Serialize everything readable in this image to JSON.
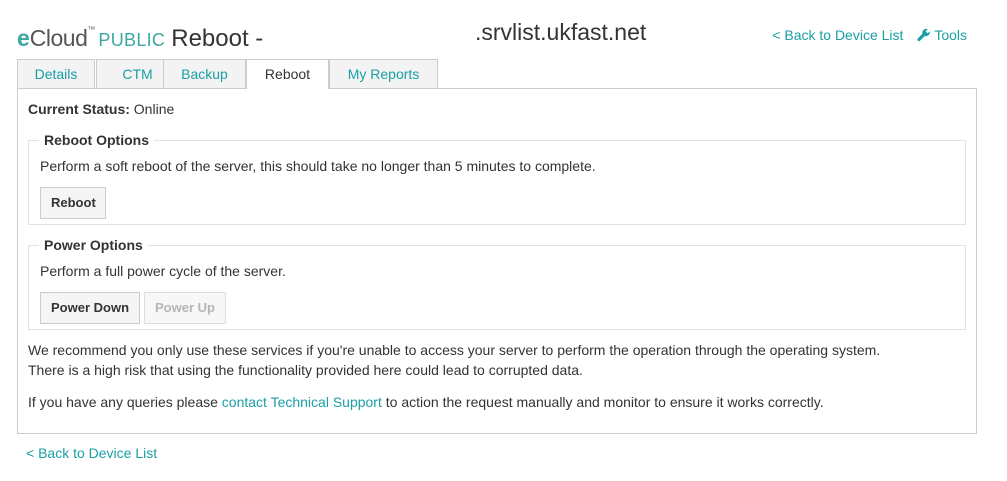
{
  "header": {
    "brand_e": "e",
    "brand_cloud": "Cloud",
    "brand_tm": "™",
    "brand_public": "PUBLIC",
    "page_title": "Reboot -",
    "hostname": ".srvlist.ukfast.net",
    "back_link": "< Back to Device List",
    "tools_link": "Tools"
  },
  "tabs": [
    {
      "label": "Details",
      "active": false
    },
    {
      "label": "CTM",
      "active": false
    },
    {
      "label": "Backup",
      "active": false
    },
    {
      "label": "Reboot",
      "active": true
    },
    {
      "label": "My Reports",
      "active": false
    }
  ],
  "status": {
    "label": "Current Status:",
    "value": "Online"
  },
  "reboot_options": {
    "legend": "Reboot Options",
    "description": "Perform a soft reboot of the server, this should take no longer than 5 minutes to complete.",
    "reboot_button": "Reboot"
  },
  "power_options": {
    "legend": "Power Options",
    "description": "Perform a full power cycle of the server.",
    "power_down_button": "Power Down",
    "power_up_button": "Power Up",
    "power_up_disabled": true
  },
  "notes": {
    "warning_line1": "We recommend you only use these services if you're unable to access your server to perform the operation through the operating system.",
    "warning_line2": "There is a high risk that using the functionality provided here could lead to corrupted data.",
    "queries_prefix": "If you have any queries please ",
    "queries_link": "contact Technical Support",
    "queries_suffix": " to action the request manually and monitor to ensure it works correctly."
  },
  "footer": {
    "back_link": "< Back to Device List"
  },
  "colors": {
    "accent": "#1a9fa5",
    "brand": "#3ca89f",
    "border": "#cccccc"
  },
  "icons": [
    "wrench-icon"
  ]
}
